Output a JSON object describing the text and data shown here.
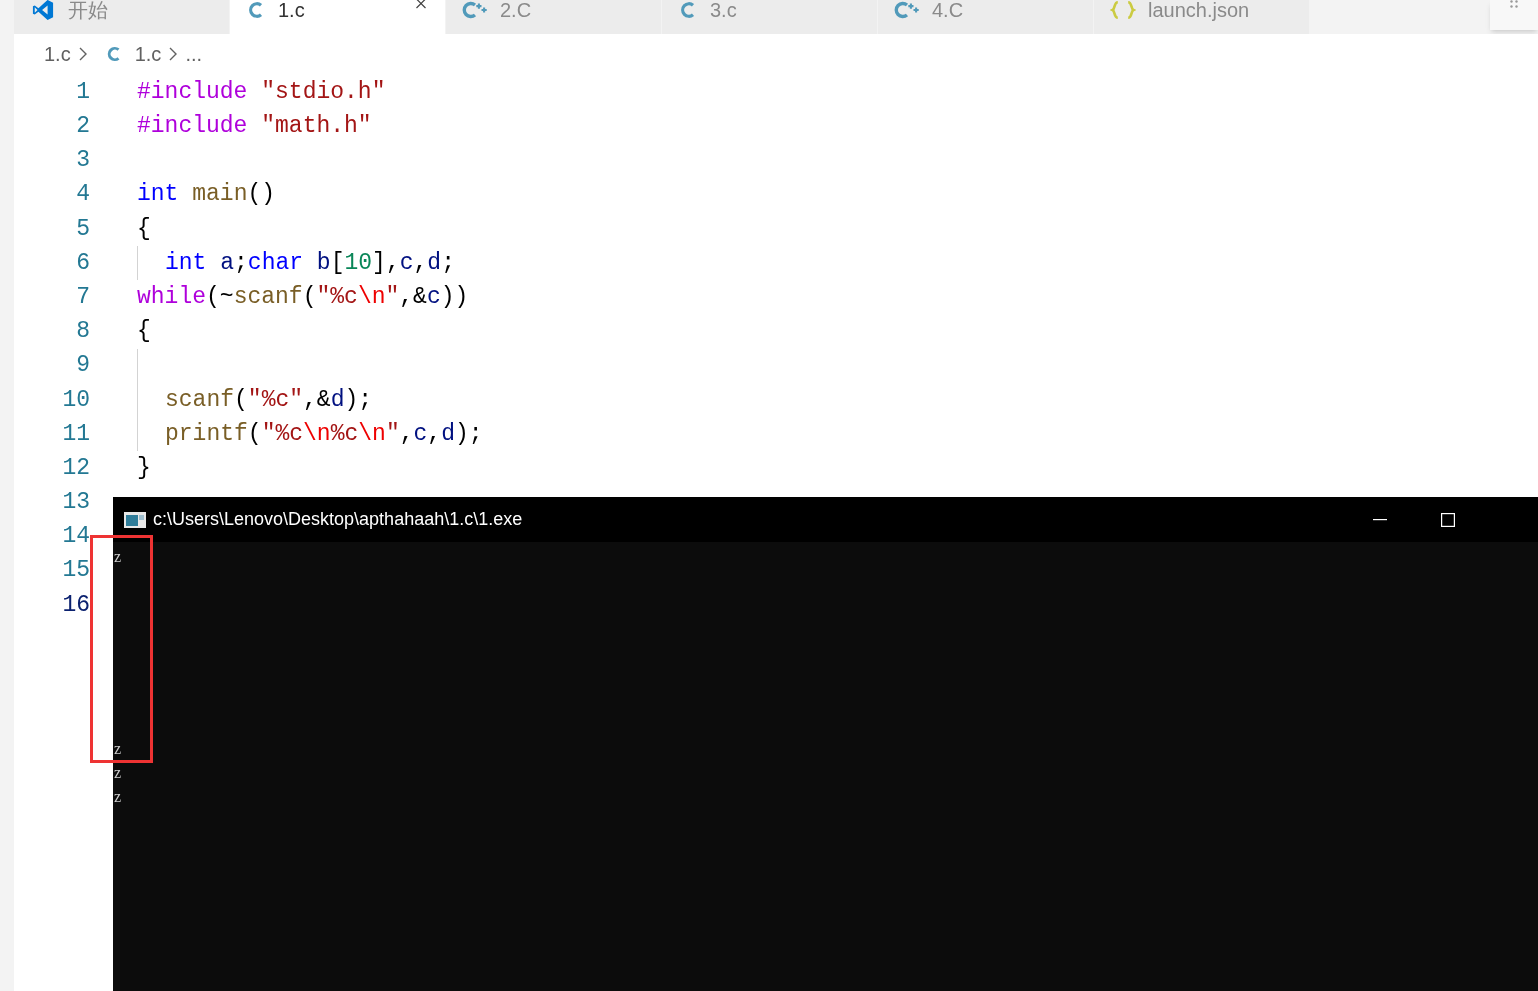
{
  "tabs": [
    {
      "label": "开始",
      "kind": "vscode",
      "selected": false
    },
    {
      "label": "1.c",
      "kind": "c",
      "selected": true
    },
    {
      "label": "2.C",
      "kind": "cpp",
      "selected": false
    },
    {
      "label": "3.c",
      "kind": "c",
      "selected": false
    },
    {
      "label": "4.C",
      "kind": "cpp",
      "selected": false
    },
    {
      "label": "launch.json",
      "kind": "json",
      "selected": false
    }
  ],
  "breadcrumb": [
    {
      "label": "1.c",
      "kind": "plain"
    },
    {
      "label": "1.c",
      "kind": "c"
    },
    {
      "label": "...",
      "kind": "plain"
    }
  ],
  "code_lines": [
    {
      "number": "1",
      "active": false,
      "indent": false,
      "tokens": [
        {
          "t": "#include",
          "kind": "macro"
        },
        {
          "t": " \"stdio.h\"",
          "kind": "string"
        }
      ]
    },
    {
      "number": "2",
      "active": false,
      "indent": false,
      "tokens": [
        {
          "t": "#include",
          "kind": "macro"
        },
        {
          "t": " \"math.h\"",
          "kind": "string"
        }
      ]
    },
    {
      "number": "3",
      "active": false,
      "indent": false
    },
    {
      "number": "4",
      "active": false,
      "indent": false,
      "tokens": [
        {
          "t": "int",
          "kind": "keyword"
        },
        {
          "t": " main",
          "kind": "function"
        },
        {
          "t": "()",
          "kind": "plain"
        }
      ]
    },
    {
      "number": "5",
      "active": false,
      "indent": false,
      "tokens": [
        {
          "t": "{",
          "kind": "plain"
        }
      ]
    },
    {
      "number": "6",
      "active": false,
      "indent": true,
      "tokens": [
        {
          "t": "int",
          "kind": "keyword"
        },
        {
          "t": " a",
          "kind": "variable"
        },
        {
          "t": ";",
          "kind": "plain"
        },
        {
          "t": "char",
          "kind": "keyword"
        },
        {
          "t": " b",
          "kind": "variable"
        },
        {
          "t": "[",
          "kind": "plain"
        },
        {
          "t": "10",
          "kind": "number"
        },
        {
          "t": "],",
          "kind": "plain"
        },
        {
          "t": "c",
          "kind": "variable"
        },
        {
          "t": ",",
          "kind": "plain"
        },
        {
          "t": "d",
          "kind": "variable"
        },
        {
          "t": ";",
          "kind": "plain"
        }
      ]
    },
    {
      "number": "7",
      "active": false,
      "indent": false,
      "tokens": [
        {
          "t": "while",
          "kind": "control"
        },
        {
          "t": "(~",
          "kind": "plain"
        },
        {
          "t": "scanf",
          "kind": "function"
        },
        {
          "t": "(",
          "kind": "plain"
        },
        {
          "t": "\"%c",
          "kind": "string"
        },
        {
          "t": "\\n",
          "kind": "escape"
        },
        {
          "t": "\"",
          "kind": "string"
        },
        {
          "t": ",&",
          "kind": "plain"
        },
        {
          "t": "c",
          "kind": "variable"
        },
        {
          "t": "))",
          "kind": "plain"
        }
      ]
    },
    {
      "number": "8",
      "active": false,
      "indent": false,
      "tokens": [
        {
          "t": "{",
          "kind": "plain"
        }
      ]
    },
    {
      "number": "9",
      "active": false,
      "indent": true
    },
    {
      "number": "10",
      "active": false,
      "indent": true,
      "tokens": [
        {
          "t": "scanf",
          "kind": "function"
        },
        {
          "t": "(",
          "kind": "plain"
        },
        {
          "t": "\"%c\"",
          "kind": "string"
        },
        {
          "t": ",&",
          "kind": "plain"
        },
        {
          "t": "d",
          "kind": "variable"
        },
        {
          "t": ");",
          "kind": "plain"
        }
      ]
    },
    {
      "number": "11",
      "active": false,
      "indent": true,
      "tokens": [
        {
          "t": "printf",
          "kind": "function"
        },
        {
          "t": "(",
          "kind": "plain"
        },
        {
          "t": "\"%c",
          "kind": "string"
        },
        {
          "t": "\\n",
          "kind": "escape"
        },
        {
          "t": "%c",
          "kind": "string"
        },
        {
          "t": "\\n",
          "kind": "escape"
        },
        {
          "t": "\"",
          "kind": "string"
        },
        {
          "t": ",",
          "kind": "plain"
        },
        {
          "t": "c",
          "kind": "variable"
        },
        {
          "t": ",",
          "kind": "plain"
        },
        {
          "t": "d",
          "kind": "variable"
        },
        {
          "t": ");",
          "kind": "plain"
        }
      ]
    },
    {
      "number": "12",
      "active": false,
      "indent": false,
      "tokens": [
        {
          "t": "}",
          "kind": "plain"
        }
      ]
    },
    {
      "number": "13",
      "active": false,
      "indent": false
    },
    {
      "number": "14",
      "active": false,
      "indent": false
    },
    {
      "number": "15",
      "active": false,
      "indent": false
    },
    {
      "number": "16",
      "active": true,
      "indent": false
    }
  ],
  "console": {
    "title": "c:\\Users\\Lenovo\\Desktop\\apthahaah\\1.c\\1.exe",
    "output_top": [
      "z"
    ],
    "output_bottom": [
      "z",
      "z",
      "z"
    ]
  }
}
